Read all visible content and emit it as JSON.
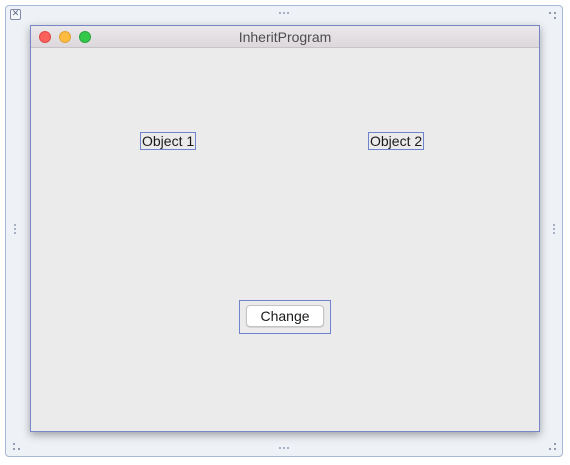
{
  "canvas": {
    "close_badge_icon": "close-x-icon",
    "close_badge_glyph": "✕",
    "border_color": "#a9b7d8"
  },
  "window": {
    "title": "InheritProgram",
    "traffic_lights": {
      "close_color": "#fc605b",
      "minimize_color": "#fdbc40",
      "zoom_color": "#34c84a"
    },
    "selection_color": "#6f82cc"
  },
  "content": {
    "label_1": "Object 1",
    "label_2": "Object 2",
    "change_button_label": "Change"
  }
}
